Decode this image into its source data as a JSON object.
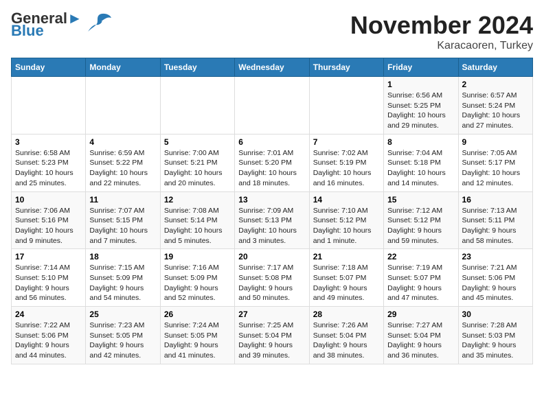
{
  "logo": {
    "line1": "General",
    "line2": "Blue"
  },
  "title": "November 2024",
  "subtitle": "Karacaoren, Turkey",
  "weekdays": [
    "Sunday",
    "Monday",
    "Tuesday",
    "Wednesday",
    "Thursday",
    "Friday",
    "Saturday"
  ],
  "weeks": [
    [
      {
        "day": "",
        "info": ""
      },
      {
        "day": "",
        "info": ""
      },
      {
        "day": "",
        "info": ""
      },
      {
        "day": "",
        "info": ""
      },
      {
        "day": "",
        "info": ""
      },
      {
        "day": "1",
        "info": "Sunrise: 6:56 AM\nSunset: 5:25 PM\nDaylight: 10 hours and 29 minutes."
      },
      {
        "day": "2",
        "info": "Sunrise: 6:57 AM\nSunset: 5:24 PM\nDaylight: 10 hours and 27 minutes."
      }
    ],
    [
      {
        "day": "3",
        "info": "Sunrise: 6:58 AM\nSunset: 5:23 PM\nDaylight: 10 hours and 25 minutes."
      },
      {
        "day": "4",
        "info": "Sunrise: 6:59 AM\nSunset: 5:22 PM\nDaylight: 10 hours and 22 minutes."
      },
      {
        "day": "5",
        "info": "Sunrise: 7:00 AM\nSunset: 5:21 PM\nDaylight: 10 hours and 20 minutes."
      },
      {
        "day": "6",
        "info": "Sunrise: 7:01 AM\nSunset: 5:20 PM\nDaylight: 10 hours and 18 minutes."
      },
      {
        "day": "7",
        "info": "Sunrise: 7:02 AM\nSunset: 5:19 PM\nDaylight: 10 hours and 16 minutes."
      },
      {
        "day": "8",
        "info": "Sunrise: 7:04 AM\nSunset: 5:18 PM\nDaylight: 10 hours and 14 minutes."
      },
      {
        "day": "9",
        "info": "Sunrise: 7:05 AM\nSunset: 5:17 PM\nDaylight: 10 hours and 12 minutes."
      }
    ],
    [
      {
        "day": "10",
        "info": "Sunrise: 7:06 AM\nSunset: 5:16 PM\nDaylight: 10 hours and 9 minutes."
      },
      {
        "day": "11",
        "info": "Sunrise: 7:07 AM\nSunset: 5:15 PM\nDaylight: 10 hours and 7 minutes."
      },
      {
        "day": "12",
        "info": "Sunrise: 7:08 AM\nSunset: 5:14 PM\nDaylight: 10 hours and 5 minutes."
      },
      {
        "day": "13",
        "info": "Sunrise: 7:09 AM\nSunset: 5:13 PM\nDaylight: 10 hours and 3 minutes."
      },
      {
        "day": "14",
        "info": "Sunrise: 7:10 AM\nSunset: 5:12 PM\nDaylight: 10 hours and 1 minute."
      },
      {
        "day": "15",
        "info": "Sunrise: 7:12 AM\nSunset: 5:12 PM\nDaylight: 9 hours and 59 minutes."
      },
      {
        "day": "16",
        "info": "Sunrise: 7:13 AM\nSunset: 5:11 PM\nDaylight: 9 hours and 58 minutes."
      }
    ],
    [
      {
        "day": "17",
        "info": "Sunrise: 7:14 AM\nSunset: 5:10 PM\nDaylight: 9 hours and 56 minutes."
      },
      {
        "day": "18",
        "info": "Sunrise: 7:15 AM\nSunset: 5:09 PM\nDaylight: 9 hours and 54 minutes."
      },
      {
        "day": "19",
        "info": "Sunrise: 7:16 AM\nSunset: 5:09 PM\nDaylight: 9 hours and 52 minutes."
      },
      {
        "day": "20",
        "info": "Sunrise: 7:17 AM\nSunset: 5:08 PM\nDaylight: 9 hours and 50 minutes."
      },
      {
        "day": "21",
        "info": "Sunrise: 7:18 AM\nSunset: 5:07 PM\nDaylight: 9 hours and 49 minutes."
      },
      {
        "day": "22",
        "info": "Sunrise: 7:19 AM\nSunset: 5:07 PM\nDaylight: 9 hours and 47 minutes."
      },
      {
        "day": "23",
        "info": "Sunrise: 7:21 AM\nSunset: 5:06 PM\nDaylight: 9 hours and 45 minutes."
      }
    ],
    [
      {
        "day": "24",
        "info": "Sunrise: 7:22 AM\nSunset: 5:06 PM\nDaylight: 9 hours and 44 minutes."
      },
      {
        "day": "25",
        "info": "Sunrise: 7:23 AM\nSunset: 5:05 PM\nDaylight: 9 hours and 42 minutes."
      },
      {
        "day": "26",
        "info": "Sunrise: 7:24 AM\nSunset: 5:05 PM\nDaylight: 9 hours and 41 minutes."
      },
      {
        "day": "27",
        "info": "Sunrise: 7:25 AM\nSunset: 5:04 PM\nDaylight: 9 hours and 39 minutes."
      },
      {
        "day": "28",
        "info": "Sunrise: 7:26 AM\nSunset: 5:04 PM\nDaylight: 9 hours and 38 minutes."
      },
      {
        "day": "29",
        "info": "Sunrise: 7:27 AM\nSunset: 5:04 PM\nDaylight: 9 hours and 36 minutes."
      },
      {
        "day": "30",
        "info": "Sunrise: 7:28 AM\nSunset: 5:03 PM\nDaylight: 9 hours and 35 minutes."
      }
    ]
  ]
}
